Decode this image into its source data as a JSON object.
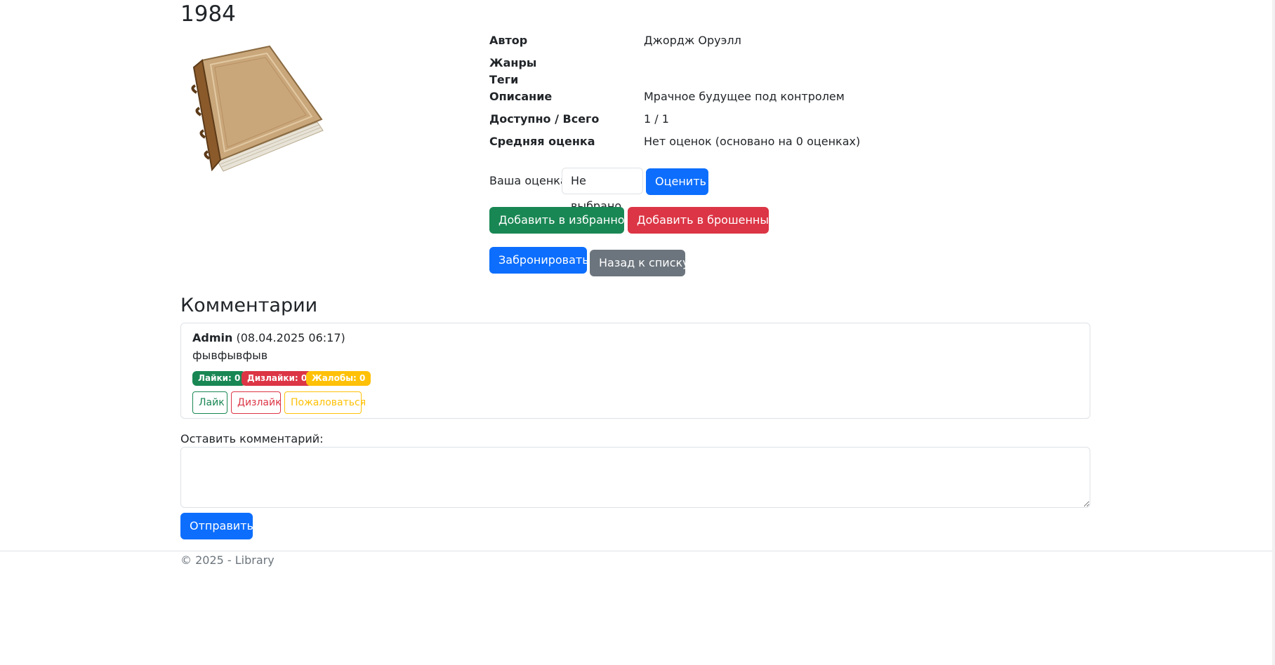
{
  "book": {
    "title": "1984",
    "author_label": "Автор",
    "author": "Джордж Оруэлл",
    "genres_label": "Жанры",
    "genres": "",
    "tags_label": "Теги",
    "tags": "",
    "description_label": "Описание",
    "description": "Мрачное будущее под контролем",
    "availability_label": "Доступно / Всего",
    "availability": "1 / 1",
    "rating_label": "Средняя оценка",
    "rating": "Нет оценок (основано на 0 оценках)"
  },
  "rating_form": {
    "label": "Ваша оценка:",
    "select_value": "Не выбрано",
    "submit_label": "Оценить"
  },
  "actions": {
    "favorite_label": "Добавить в избранное",
    "abandoned_label": "Добавить в брошенные",
    "reserve_label": "Забронировать",
    "back_label": "Назад к списку"
  },
  "comments": {
    "heading": "Комментарии",
    "items": [
      {
        "author": "Admin",
        "date": "(08.04.2025 06:17)",
        "text": "фывфывфыв",
        "likes_badge": "Лайки: 0",
        "dislikes_badge": "Дизлайки: 0",
        "complaints_badge": "Жалобы: 0",
        "like_label": "Лайк",
        "dislike_label": "Дизлайк",
        "complain_label": "Пожаловаться"
      }
    ],
    "form_label": "Оставить комментарий:",
    "textarea_value": "",
    "submit_label": "Отправить"
  },
  "footer": {
    "text": "© 2025 - Library"
  },
  "colors": {
    "primary": "#0d6efd",
    "success": "#198754",
    "danger": "#dc3545",
    "warning": "#ffc107",
    "secondary": "#6c757d"
  },
  "icons": {
    "cover": "book-cover-icon"
  }
}
